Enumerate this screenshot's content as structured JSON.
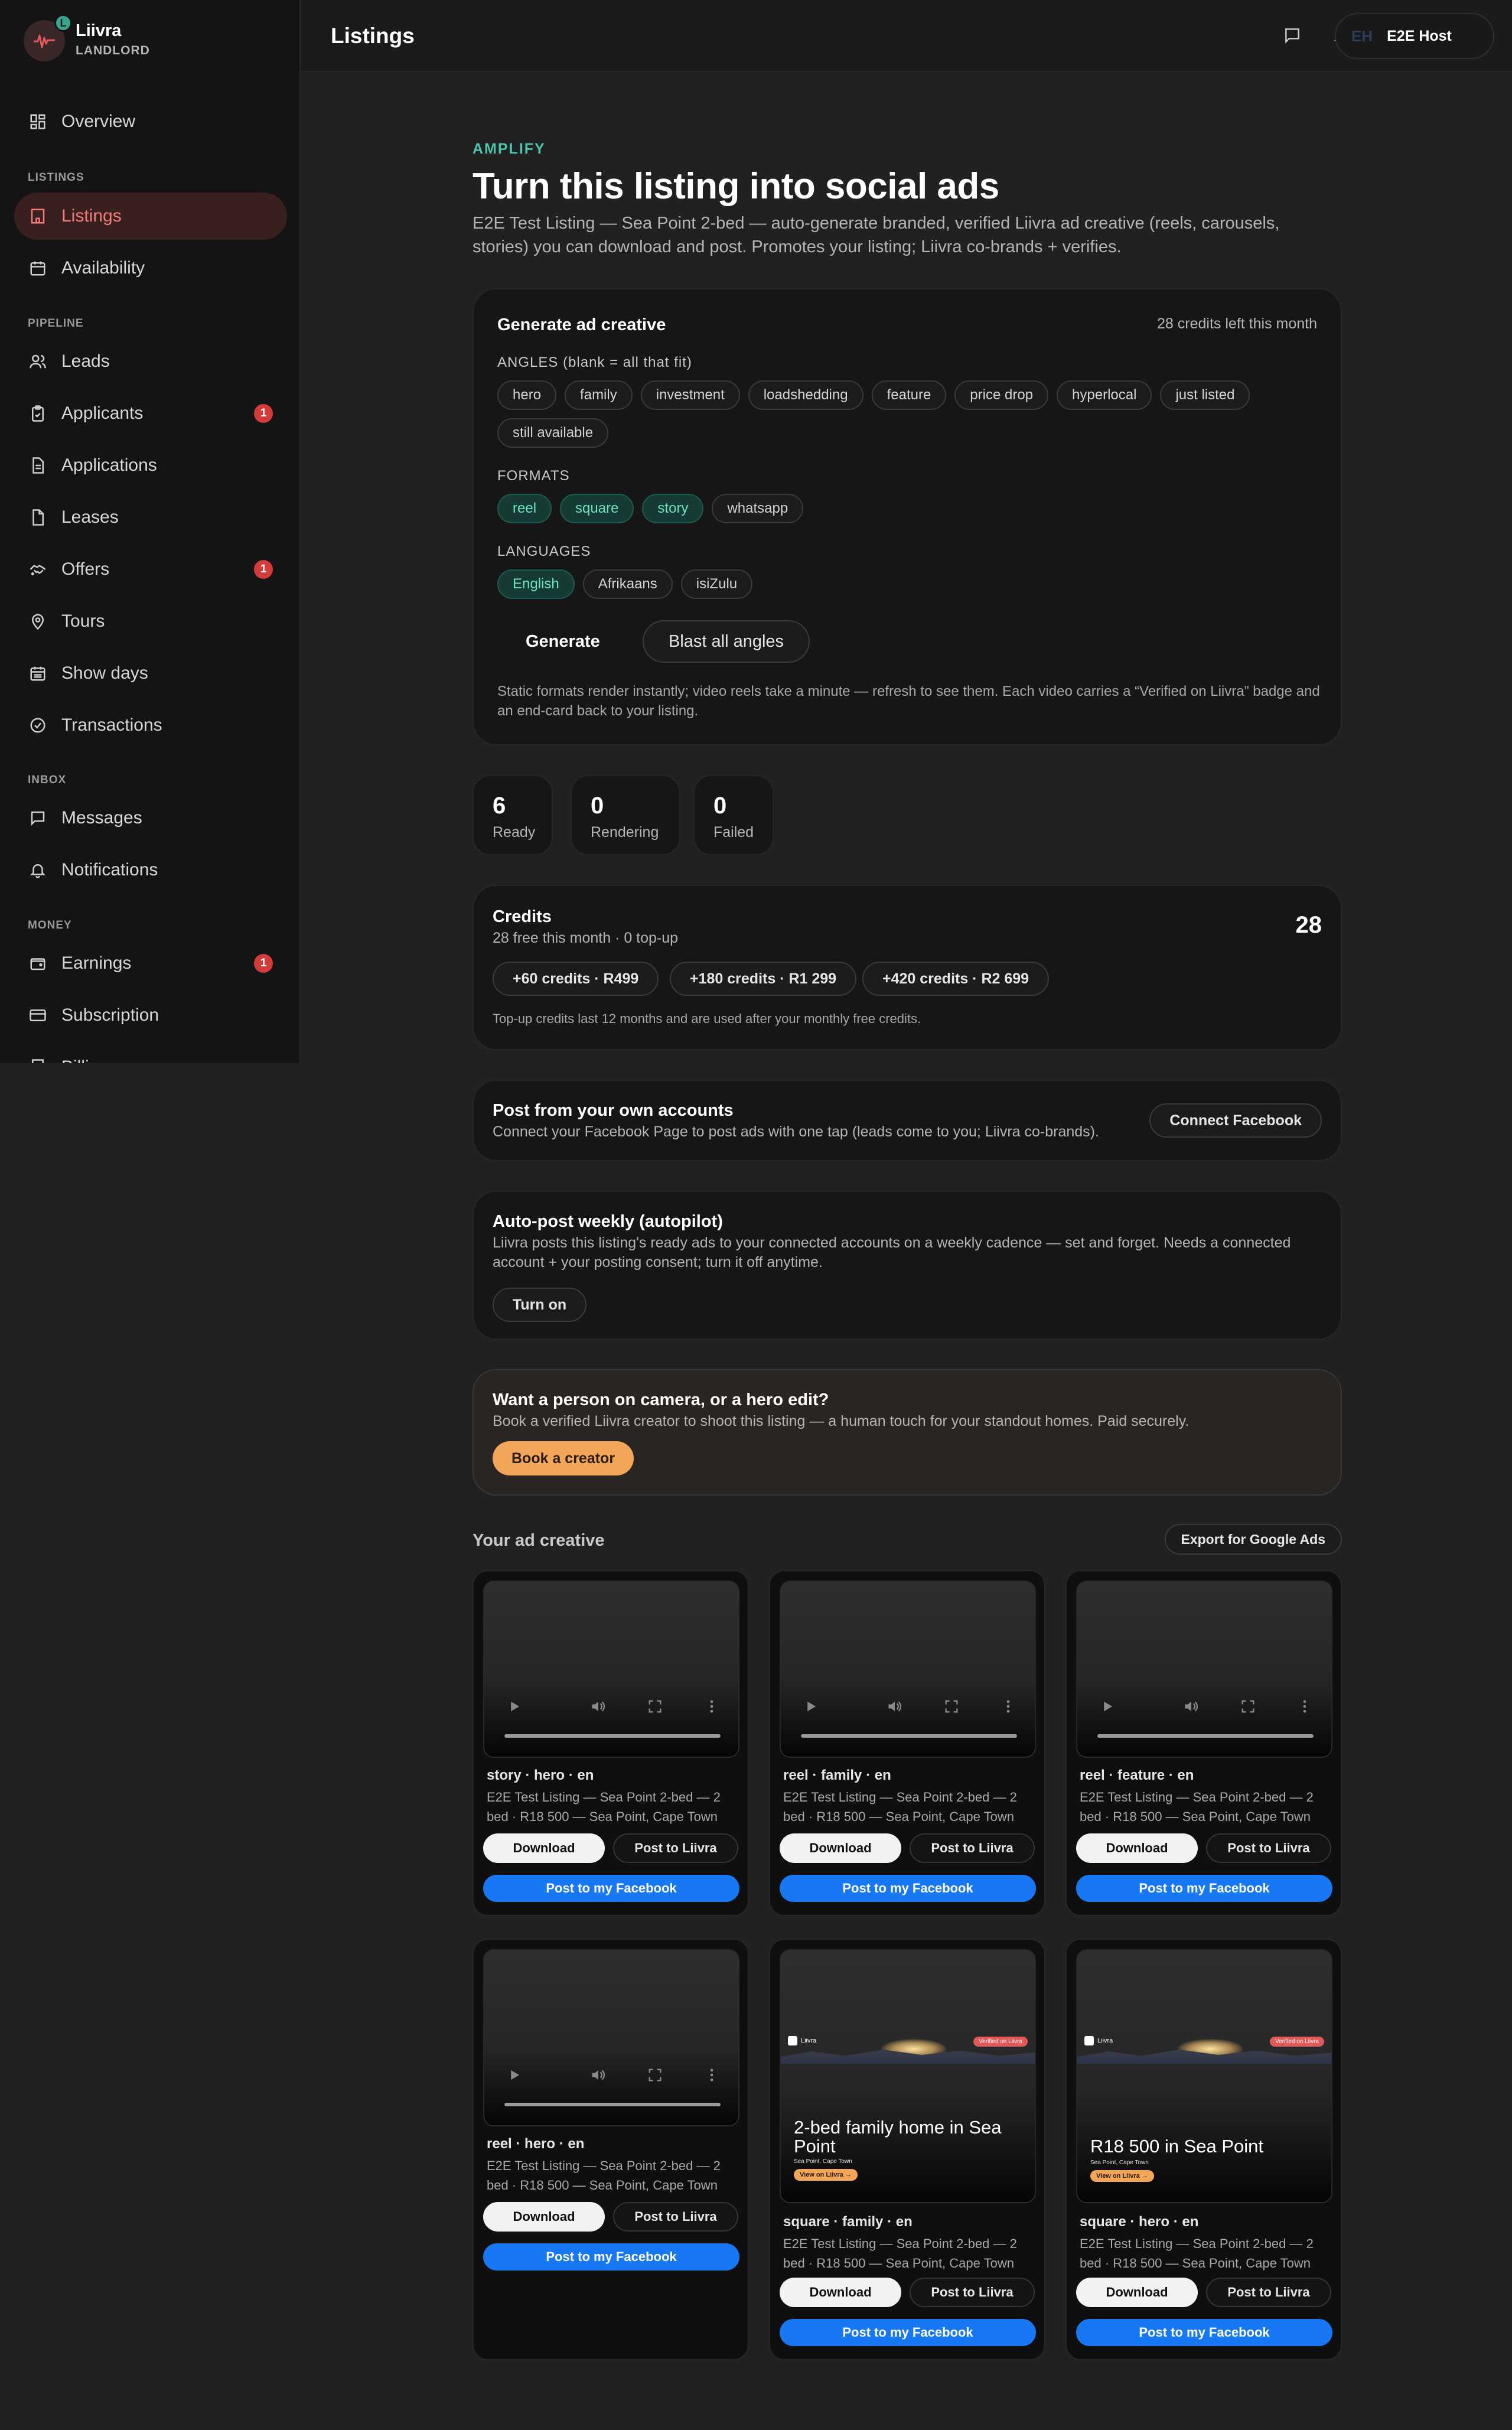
{
  "brand": {
    "name": "Liivra",
    "role": "LANDLORD",
    "badge": "L"
  },
  "sidebar": {
    "sections": [
      "LISTINGS",
      "PIPELINE",
      "INBOX",
      "MONEY"
    ],
    "items": [
      {
        "label": "Overview",
        "icon": "grid-icon"
      },
      {
        "label": "Listings",
        "icon": "building-icon",
        "active": true
      },
      {
        "label": "Availability",
        "icon": "calendar-icon"
      },
      {
        "label": "Leads",
        "icon": "users-icon"
      },
      {
        "label": "Applicants",
        "icon": "clipboard-icon",
        "badge": "1"
      },
      {
        "label": "Applications",
        "icon": "document-icon"
      },
      {
        "label": "Leases",
        "icon": "file-icon"
      },
      {
        "label": "Offers",
        "icon": "handshake-icon",
        "badge": "1"
      },
      {
        "label": "Tours",
        "icon": "map-pin-icon"
      },
      {
        "label": "Show days",
        "icon": "calendar-grid-icon"
      },
      {
        "label": "Transactions",
        "icon": "check-circle-icon"
      },
      {
        "label": "Messages",
        "icon": "message-icon"
      },
      {
        "label": "Notifications",
        "icon": "bell-icon"
      },
      {
        "label": "Earnings",
        "icon": "wallet-icon",
        "badge": "1"
      },
      {
        "label": "Subscription",
        "icon": "card-icon"
      },
      {
        "label": "Billi",
        "icon": "receipt-icon"
      }
    ]
  },
  "topbar": {
    "title": "Listings",
    "user_initials": "EH",
    "user_name": "E2E Host"
  },
  "hero": {
    "eyebrow": "AMPLIFY",
    "title": "Turn this listing into social ads",
    "subtitle": "E2E Test Listing — Sea Point 2-bed — auto-generate branded, verified Liivra ad creative (reels, carousels, stories) you can download and post. Promotes your listing; Liivra co-brands + verifies."
  },
  "generator": {
    "title": "Generate ad creative",
    "credits_left": "28 credits left this month",
    "angles_label": "ANGLES",
    "angles_hint": "(blank = all that fit)",
    "angles": [
      "hero",
      "family",
      "investment",
      "loadshedding",
      "feature",
      "price drop",
      "hyperlocal",
      "just listed",
      "still available"
    ],
    "formats_label": "FORMATS",
    "formats": [
      {
        "label": "reel",
        "selected": true
      },
      {
        "label": "square",
        "selected": true
      },
      {
        "label": "story",
        "selected": true
      },
      {
        "label": "whatsapp",
        "selected": false
      }
    ],
    "languages_label": "LANGUAGES",
    "languages": [
      {
        "label": "English",
        "selected": true
      },
      {
        "label": "Afrikaans",
        "selected": false
      },
      {
        "label": "isiZulu",
        "selected": false
      }
    ],
    "generate_label": "Generate",
    "blast_label": "Blast all angles",
    "note": "Static formats render instantly; video reels take a minute — refresh to see them. Each video carries a “Verified on Liivra” badge and an end-card back to your listing."
  },
  "stats": [
    {
      "value": "6",
      "label": "Ready"
    },
    {
      "value": "0",
      "label": "Rendering"
    },
    {
      "value": "0",
      "label": "Failed"
    }
  ],
  "credits": {
    "title": "Credits",
    "subtitle": "28 free this month · 0 top-up",
    "total": "28",
    "packs": [
      "+60 credits · R499",
      "+180 credits · R1 299",
      "+420 credits · R2 699"
    ],
    "note": "Top-up credits last 12 months and are used after your monthly free credits."
  },
  "own_accounts": {
    "title": "Post from your own accounts",
    "subtitle": "Connect your Facebook Page to post ads with one tap (leads come to you; Liivra co-brands).",
    "button": "Connect Facebook"
  },
  "autopost": {
    "title": "Auto-post weekly (autopilot)",
    "subtitle": "Liivra posts this listing's ready ads to your connected accounts on a weekly cadence — set and forget. Needs a connected account + your posting consent; turn it off anytime.",
    "button": "Turn on"
  },
  "creator": {
    "title": "Want a person on camera, or a hero edit?",
    "subtitle": "Book a verified Liivra creator to shoot this listing — a human touch for your standout homes. Paid securely.",
    "button": "Book a creator"
  },
  "creative": {
    "heading": "Your ad creative",
    "export_label": "Export for Google Ads",
    "download_label": "Download",
    "post_liivra_label": "Post to Liivra",
    "post_fb_label": "Post to my Facebook",
    "items": [
      {
        "meta": "story · hero · en",
        "desc": "E2E Test Listing — Sea Point 2-bed — 2 bed · R18 500 — Sea Point, Cape Town",
        "kind": "video"
      },
      {
        "meta": "reel · family · en",
        "desc": "E2E Test Listing — Sea Point 2-bed — 2 bed · R18 500 — Sea Point, Cape Town",
        "kind": "video"
      },
      {
        "meta": "reel · feature · en",
        "desc": "E2E Test Listing — Sea Point 2-bed — 2 bed · R18 500 — Sea Point, Cape Town",
        "kind": "video"
      },
      {
        "meta": "reel · hero · en",
        "desc": "E2E Test Listing — Sea Point 2-bed — 2 bed · R18 500 — Sea Point, Cape Town",
        "kind": "video"
      },
      {
        "meta": "square · family · en",
        "desc": "E2E Test Listing — Sea Point 2-bed — 2 bed · R18 500 — Sea Point, Cape Town",
        "kind": "image",
        "overlay": {
          "brand": "Liivra",
          "badge": "Verified on Liivra",
          "title": "2-bed family home in Sea Point",
          "location": "Sea Point, Cape Town",
          "cta": "View on Liivra →"
        }
      },
      {
        "meta": "square · hero · en",
        "desc": "E2E Test Listing — Sea Point 2-bed — 2 bed · R18 500 — Sea Point, Cape Town",
        "kind": "image",
        "overlay": {
          "brand": "Liivra",
          "badge": "Verified on Liivra",
          "title": "R18 500 in Sea Point",
          "location": "Sea Point, Cape Town",
          "cta": "View on Liivra →"
        }
      }
    ]
  },
  "colors": {
    "accent": "#f27b7b",
    "teal": "#4ec3ad",
    "facebook": "#1877f2",
    "creator": "#f2a65a",
    "badge": "#d43b3b"
  }
}
